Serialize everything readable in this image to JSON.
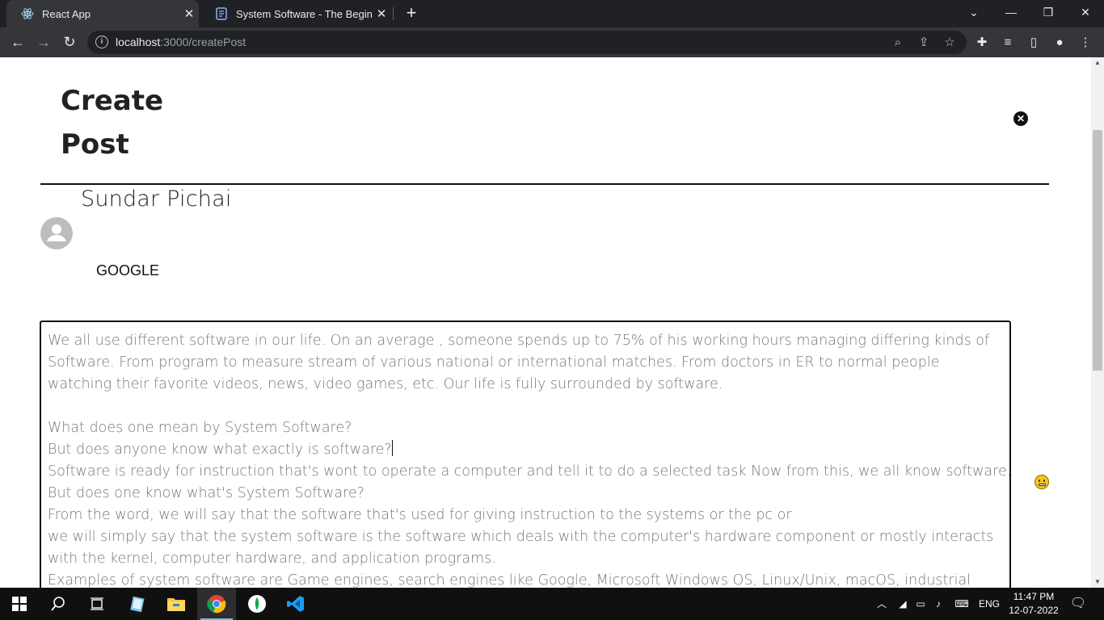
{
  "browser": {
    "tabs": [
      {
        "title": "React App",
        "active": true
      },
      {
        "title": "System Software - The Beginning",
        "active": false
      }
    ],
    "url_host": "localhost",
    "url_path": ":3000/createPost"
  },
  "page": {
    "heading_line1": "Create",
    "heading_line2": "Post",
    "author_name": "Sundar Pichai",
    "company": "GOOGLE",
    "editor_lines": [
      "We all use different software in our life. On an average , someone spends up to 75% of his working hours managing differing kinds of",
      "Software. From program to measure stream of various national or international matches. From doctors in ER to normal people",
      "watching their favorite videos, news, video games, etc. Our life is fully surrounded by software.",
      "",
      "What does one mean by System Software?",
      "But does anyone know what exactly is software?",
      "Software is ready for instruction that's wont to operate a computer and tell it to do a selected task Now from this, we all know software.",
      "But does one know what's System Software?",
      "From the word, we will say that the software that's used for giving instruction to the systems or the pc or",
      "we will simply say that the system software is the software which deals with the computer's hardware component or mostly interacts",
      "with the kernel, computer hardware, and application programs.",
      "Examples of system software are Game engines, search engines like Google, Microsoft Windows OS, Linux/Unix, macOS, industrial"
    ]
  },
  "taskbar": {
    "language": "ENG",
    "time": "11:47 PM",
    "date": "12-07-2022"
  }
}
